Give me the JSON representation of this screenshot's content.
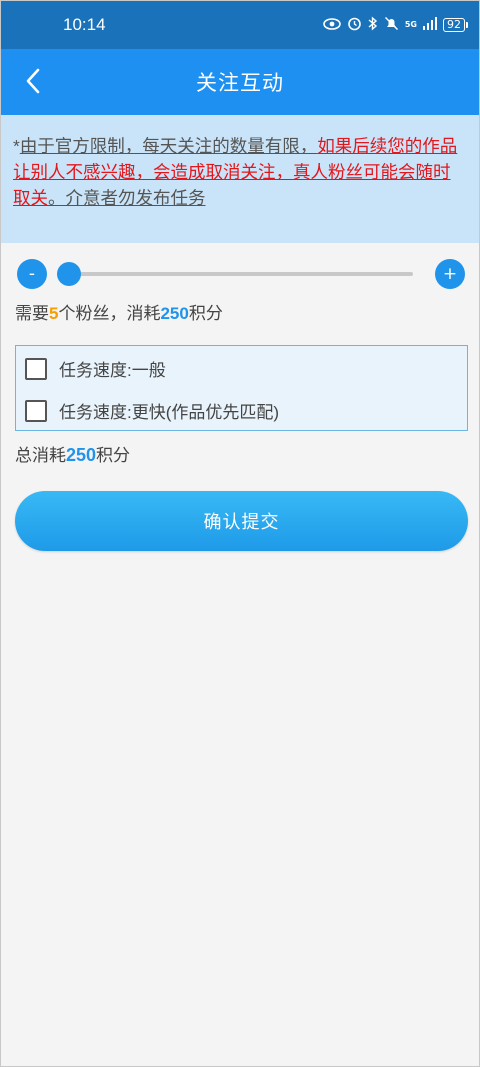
{
  "status_bar": {
    "time": "10:14",
    "network": "5G",
    "battery": "92"
  },
  "header": {
    "title": "关注互动"
  },
  "notice": {
    "prefix": "*",
    "part1": "由于官方限制，每天关注的数量有限，",
    "warning": "如果后续您的作品让别人不感兴趣，会造成取消关注，真人粉丝可能会随时取关",
    "part2": "。介意者勿发布任务",
    "warning_color": "#e3161c"
  },
  "slider": {
    "minus_label": "-",
    "plus_label": "+",
    "value_fraction": 0.0
  },
  "need": {
    "text_before": "需要",
    "fans_count": "5",
    "text_middle": "个粉丝，消耗",
    "points": "250",
    "text_after": "积分"
  },
  "options": [
    {
      "label": "任务速度:一般",
      "checked": false
    },
    {
      "label": "任务速度:更快(作品优先匹配)",
      "checked": false
    }
  ],
  "total": {
    "text_before": "总消耗",
    "points": "250",
    "text_after": "积分"
  },
  "submit": {
    "label": "确认提交"
  },
  "colors": {
    "status_bar": "#1a72ba",
    "nav_bar": "#1e90f1",
    "accent_blue": "#1f94ea",
    "accent_orange": "#f5a000",
    "notice_bg": "#c9e4f8"
  }
}
